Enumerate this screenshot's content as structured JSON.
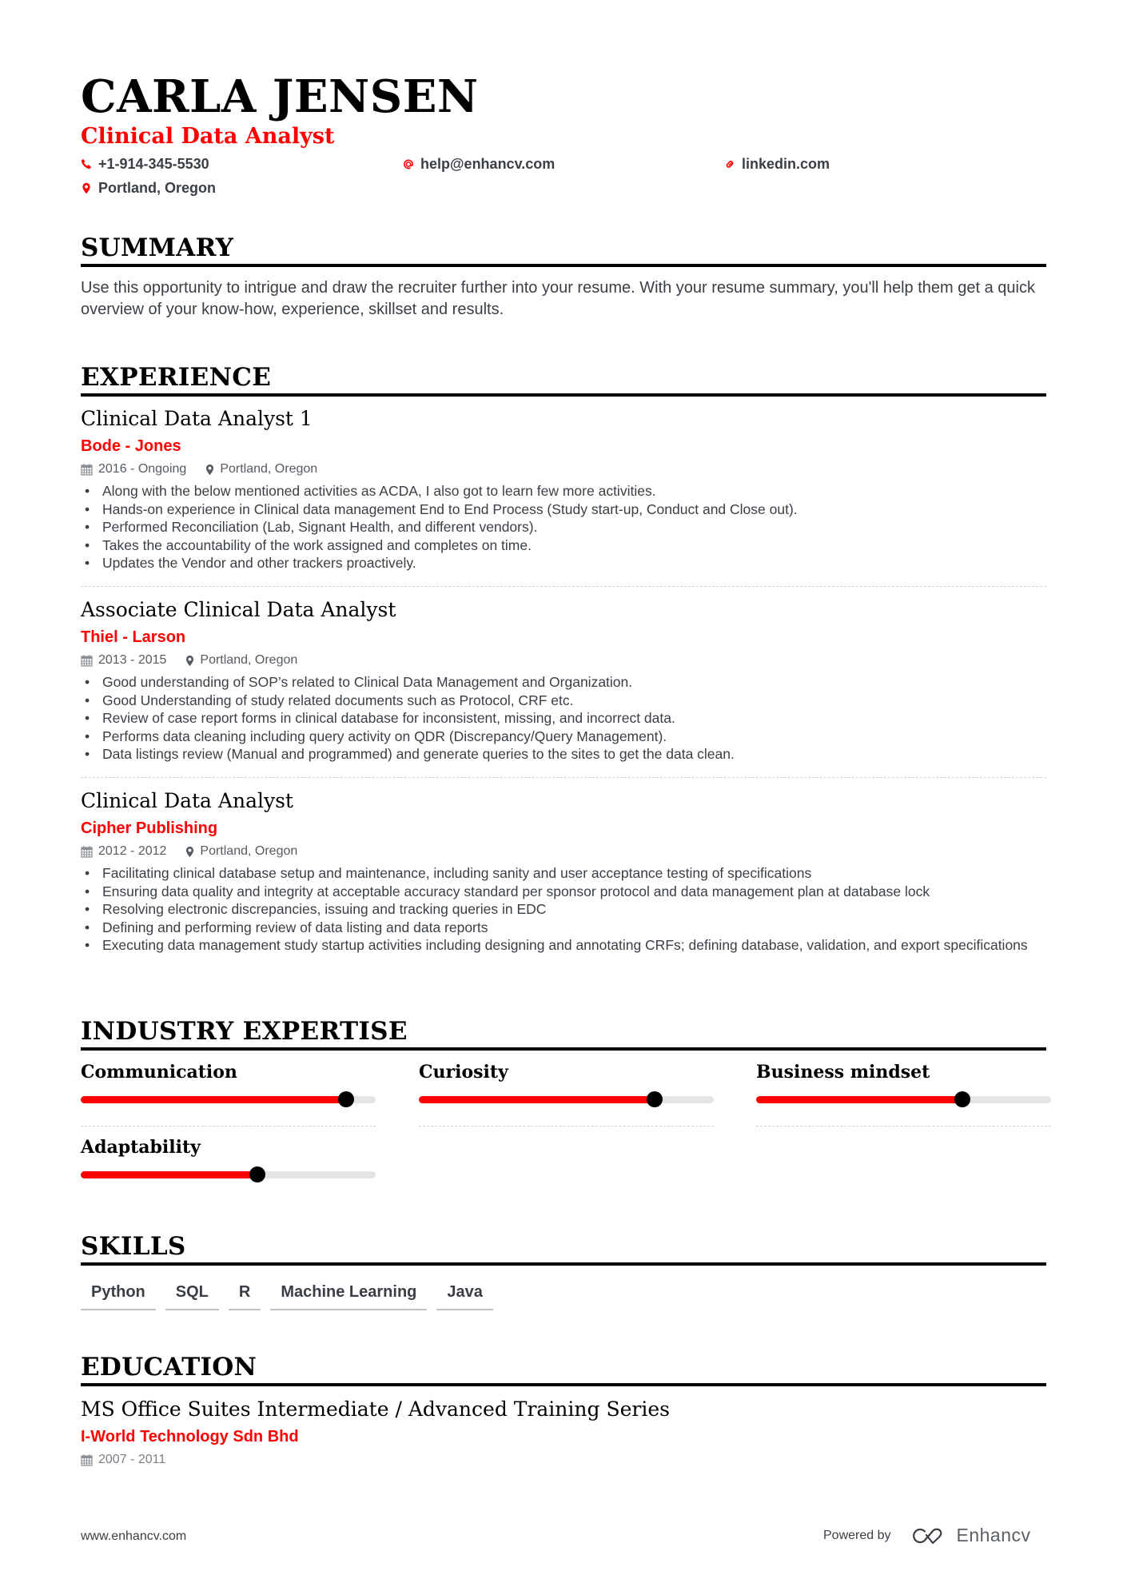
{
  "header": {
    "name": "CARLA JENSEN",
    "title": "Clinical Data Analyst",
    "contacts": [
      {
        "icon": "phone-icon",
        "text": "+1-914-345-5530"
      },
      {
        "icon": "at-icon",
        "text": "help@enhancv.com"
      },
      {
        "icon": "link-icon",
        "text": "linkedin.com"
      },
      {
        "icon": "location-pin-icon",
        "text": "Portland, Oregon"
      }
    ]
  },
  "summary": {
    "heading": "SUMMARY",
    "text": "Use this opportunity to intrigue and draw the recruiter further into your resume. With your resume summary, you'll help them get a quick overview of your know-how, experience, skillset and results."
  },
  "experience": {
    "heading": "EXPERIENCE",
    "jobs": [
      {
        "title": "Clinical Data Analyst 1",
        "company": "Bode - Jones",
        "dates": "2016 - Ongoing",
        "location": "Portland, Oregon",
        "bullets": [
          "Along with the below mentioned activities as ACDA, I also got to learn few more activities.",
          "Hands-on experience in Clinical data management End to End Process (Study start-up, Conduct and Close out).",
          "Performed Reconciliation (Lab, Signant Health, and different vendors).",
          "Takes the accountability of the work assigned and completes on time.",
          "Updates the Vendor and other trackers proactively."
        ]
      },
      {
        "title": "Associate Clinical Data Analyst",
        "company": "Thiel - Larson",
        "dates": "2013 - 2015",
        "location": "Portland, Oregon",
        "bullets": [
          "Good understanding of SOP’s related to Clinical Data Management and Organization.",
          "Good Understanding of study related documents such as Protocol, CRF etc.",
          "Review of case report forms in clinical database for inconsistent, missing, and incorrect data.",
          "Performs data cleaning including query activity on QDR (Discrepancy/Query Management).",
          "Data listings review (Manual and programmed) and generate queries to the sites to get the data clean."
        ]
      },
      {
        "title": "Clinical Data Analyst",
        "company": "Cipher Publishing",
        "dates": "2012 - 2012",
        "location": "Portland, Oregon",
        "bullets": [
          "Facilitating clinical database setup and maintenance, including sanity and user acceptance testing of specifications",
          "Ensuring data quality and integrity at acceptable accuracy standard per sponsor protocol and data management plan at database lock",
          "Resolving electronic discrepancies, issuing and tracking queries in EDC",
          "Defining and performing review of data listing and data reports",
          "Executing data management study startup activities including designing and annotating CRFs; defining database, validation, and export specifications"
        ]
      }
    ]
  },
  "expertise": {
    "heading": "INDUSTRY EXPERTISE",
    "items": [
      {
        "label": "Communication",
        "level": 0.9
      },
      {
        "label": "Curiosity",
        "level": 0.8
      },
      {
        "label": "Business mindset",
        "level": 0.7
      },
      {
        "label": "Adaptability",
        "level": 0.6
      }
    ]
  },
  "skills": {
    "heading": "SKILLS",
    "items": [
      "Python",
      "SQL",
      "R",
      "Machine Learning",
      "Java"
    ]
  },
  "education": {
    "heading": "EDUCATION",
    "entries": [
      {
        "title": "MS Office Suites Intermediate / Advanced Training Series",
        "org": "I-World Technology Sdn Bhd",
        "dates": "2007 - 2011"
      }
    ]
  },
  "footer": {
    "website": "www.enhancv.com",
    "powered_by": "Powered by",
    "brand": "Enhancv"
  },
  "colors": {
    "accent": "#ff0000",
    "text": "#3a3f45",
    "heading": "#000000",
    "bar_track": "#e4e5e7"
  }
}
